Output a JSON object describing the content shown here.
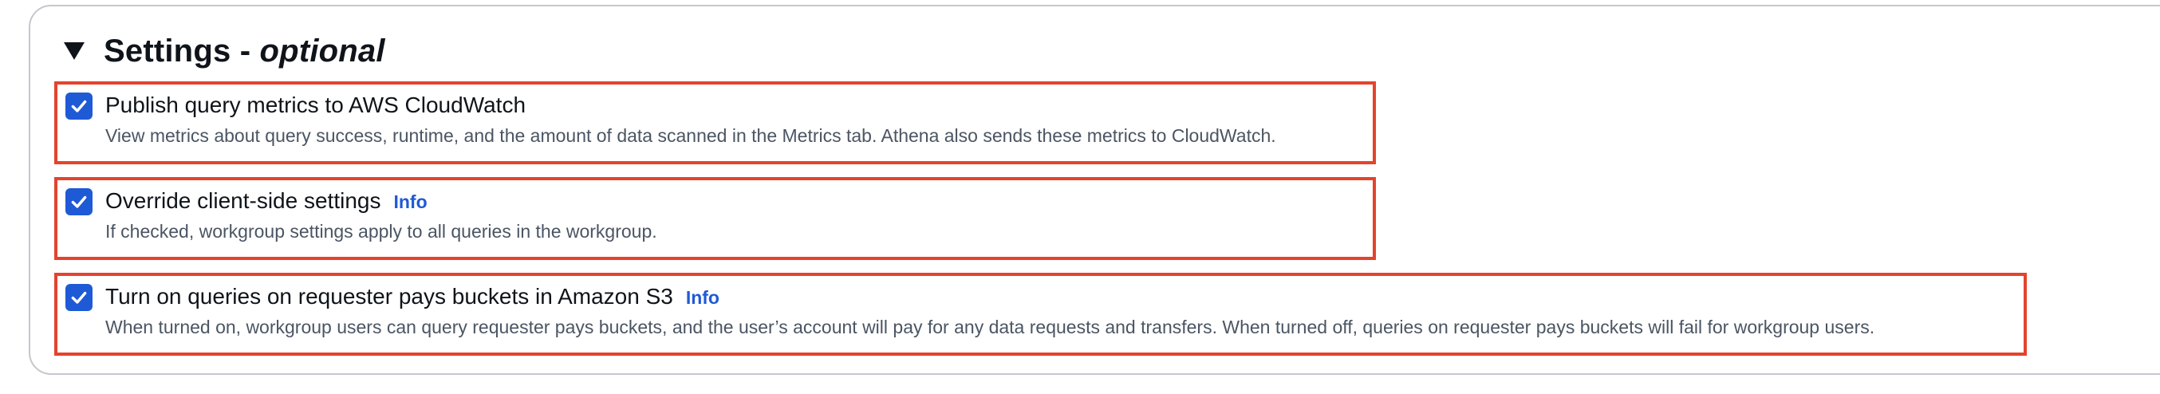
{
  "settings": {
    "title_main": "Settings - ",
    "title_optional": "optional",
    "caret_icon": "caret-down-icon",
    "highlight_color": "#e4432d",
    "checkbox_color": "#1f5ad6",
    "link_color": "#1f5ad6",
    "options": [
      {
        "label": "Publish query metrics to AWS CloudWatch",
        "info": "",
        "description": "View metrics about query success, runtime, and the amount of data scanned in the Metrics tab. Athena also sends these metrics to CloudWatch.",
        "checked": true
      },
      {
        "label": "Override client-side settings",
        "info": "Info",
        "description": "If checked, workgroup settings apply to all queries in the workgroup.",
        "checked": true
      },
      {
        "label": "Turn on queries on requester pays buckets in Amazon S3",
        "info": "Info",
        "description": "When turned on, workgroup users can query requester pays buckets, and the user’s account will pay for any data requests and transfers. When turned off, queries on requester pays buckets will fail for workgroup users.",
        "checked": true
      }
    ]
  }
}
